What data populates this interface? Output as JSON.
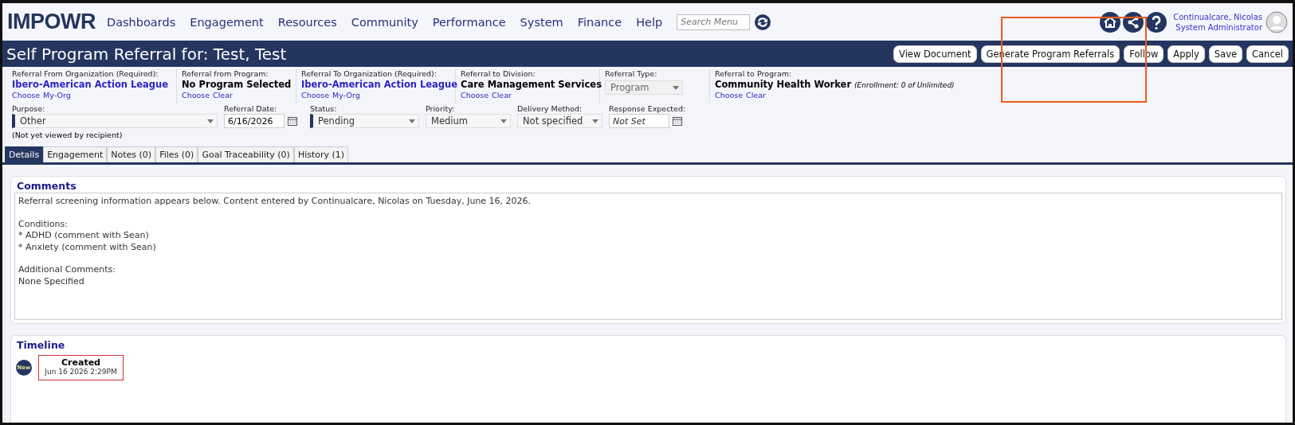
{
  "header": {
    "logo": "IMPOWR",
    "nav": [
      "Dashboards",
      "Engagement",
      "Resources",
      "Community",
      "Performance",
      "System",
      "Finance",
      "Help"
    ],
    "search": {
      "placeholder": "Search Menu"
    },
    "user": {
      "name": "Continualcare, Nicolas",
      "role": "System Administrator"
    }
  },
  "title_bar": {
    "title": "Self Program Referral for: Test, Test",
    "buttons": [
      "View Document",
      "Generate Program Referrals",
      "Follow",
      "Apply",
      "Save",
      "Cancel"
    ]
  },
  "referral_fields": [
    {
      "label": "Referral From Organization (Required):",
      "value": "Ibero-American Action League",
      "link_value": true,
      "actions": [
        "Choose",
        "My-Org"
      ]
    },
    {
      "label": "Referral from Program:",
      "value": "No Program Selected",
      "link_value": false,
      "actions": [
        "Choose",
        "Clear"
      ]
    },
    {
      "label": "Referral To Organization (Required):",
      "value": "Ibero-American Action League",
      "link_value": true,
      "actions": [
        "Choose",
        "My-Org"
      ]
    },
    {
      "label": "Referral to Division:",
      "value": "Care Management Services",
      "link_value": false,
      "actions": [
        "Choose",
        "Clear"
      ]
    },
    {
      "label": "Referral Type:",
      "kind": "select",
      "value": "Program",
      "disabled": true
    },
    {
      "label": "Referral to Program:",
      "value": "Community Health Worker",
      "note": "(Enrollment: 0 of Unlimited)",
      "link_value": false,
      "actions": [
        "Choose",
        "Clear"
      ]
    }
  ],
  "form_fields": [
    {
      "label": "Purpose:",
      "kind": "select",
      "value": "Other",
      "required": true,
      "hint": "(Not yet viewed by recipient)"
    },
    {
      "label": "Referral Date:",
      "kind": "date",
      "value": "6/16/2026"
    },
    {
      "label": "Status:",
      "kind": "select",
      "value": "Pending",
      "required": true
    },
    {
      "label": "Priority:",
      "kind": "select",
      "value": "Medium",
      "required": false
    },
    {
      "label": "Delivery Method:",
      "kind": "select",
      "value": "Not specified",
      "required": false
    },
    {
      "label": "Response Expected:",
      "kind": "date",
      "placeholder": "Not Set"
    }
  ],
  "tabs": [
    {
      "label": "Details",
      "selected": true
    },
    {
      "label": "Engagement",
      "selected": false
    },
    {
      "label": "Notes (0)",
      "selected": false
    },
    {
      "label": "Files (0)",
      "selected": false
    },
    {
      "label": "Goal Traceability (0)",
      "selected": false
    },
    {
      "label": "History (1)",
      "selected": false
    }
  ],
  "comments": {
    "title": "Comments",
    "paragraphs": [
      [
        "Referral screening information appears below. Content entered by Continualcare, Nicolas on Tuesday, June 16, 2026."
      ],
      [
        "Conditions:",
        "* ADHD (comment with Sean)",
        "* Anxiety (comment with Sean)"
      ],
      [
        "Additional Comments:",
        "None Specified"
      ]
    ]
  },
  "timeline": {
    "title": "Timeline",
    "events": [
      {
        "badge": "New",
        "title": "Created",
        "time": "Jun 16 2026 2:29PM"
      }
    ]
  },
  "annotation": {
    "kind": "highlight-frame"
  }
}
